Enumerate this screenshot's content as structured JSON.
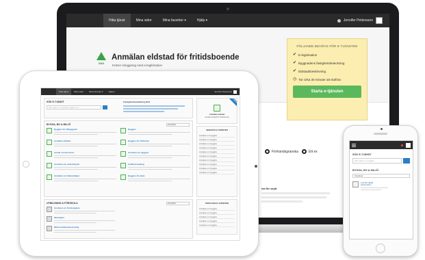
{
  "laptop": {
    "nav": {
      "items": [
        "Hitta tjänst ",
        "Mina sidor",
        "Mina favoriter ▾",
        "Hjälp ▾"
      ],
      "user_name": "Jennifer Pettersson"
    },
    "logo_label": "SBN",
    "title": "Anmälan eldstad för fritidsboende",
    "subtitle": "Kräver inloggning med e-legitimation",
    "info_box": {
      "heading": "FÖLJANDE BEHÖVS FÖR E-TJÄNSTEN",
      "items": [
        "E-legitimation",
        "Byggnadens fastighetsbeteckning",
        "Eldstadsbeskrivning",
        "Tar cirka 30 minuter att slutföra"
      ],
      "button": "Starta e-tjänsten"
    },
    "radios": [
      "Förhandsgranska",
      "Ett ex"
    ],
    "content_snippet": "lsa för skytt",
    "select": "Populärast"
  },
  "tablet": {
    "nav": {
      "items": [
        "Hitta tjänst ",
        "Mina sidor",
        "Mina favoriter ▾",
        "Hjälp ▾"
      ],
      "user_name": "Jennifer Pettersson"
    },
    "search_heading": "SÖK E-TJÄNST",
    "search_placeholder": "Sök e-tjänst, t ex ansökan, bygglov m m",
    "featured_heading": "Fastighetsbeskattning 2014",
    "section_heading": "BYGGA, BO & MILJÖ",
    "section_select": "Populärast",
    "services": [
      "Bygglov för tillbyggnad",
      "Bygglov",
      "Anmälan eldstad",
      "Bygglov för fritidshus",
      "Anmäl om fast hund",
      "Ansökan om bygglov",
      "Ansökan om strandskydd",
      "Avfallsinsamling",
      "Anmälan om fettavskiljare",
      "Bygglov för altan"
    ],
    "bottom_heading": "UTBILDNING & FÖRSKOLA",
    "bottom_items": [
      "Ansökan om förskoleplats",
      "Skolskjuts",
      "Modersmålsundervisning"
    ],
    "bottom_select": "Populärast",
    "side_feature": "Anmälan eldstad",
    "side_feature_title": "Anmälan eldstad för fritidsboende",
    "side_heading": "SENASTE E-TJÄNSTER",
    "side_items": [
      "Ansökan om bygglov",
      "Ansökan om bygglov",
      "Ansökan om bygglov",
      "Ansökan om bygglov",
      "Ansökan om bygglov",
      "Ansökan om bygglov",
      "Ansökan om bygglov",
      "Ansökan om bygglov",
      "Ansökan om bygglov",
      "Ansökan om bygglov"
    ],
    "side_heading_2": "POPULÄRA E-TJÄNSTER",
    "side_items_2": [
      "Ansökan om bygglov",
      "Ansökan om bygglov",
      "Ansökan om bygglov",
      "Ansökan om bygglov",
      "Ansökan om bygglov"
    ],
    "ribbon": "Populär"
  },
  "phone": {
    "search_heading": "SÖK E-TJÄNST",
    "search_placeholder": "Sök e-tjänst, t ex bygglov",
    "section_heading": "BYGGA, BO & MILJÖ",
    "select": "Populärast",
    "item_title": "Lov för skytt",
    "item_subtitle": "Skyltansökan"
  }
}
